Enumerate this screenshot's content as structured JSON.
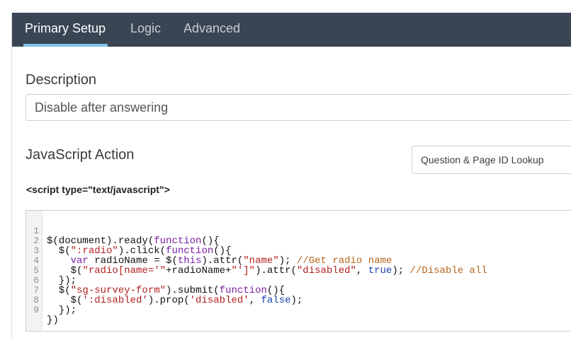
{
  "tabs": [
    "Primary Setup",
    "Logic",
    "Advanced"
  ],
  "description": {
    "label": "Description",
    "value": "Disable after answering"
  },
  "javascript_action": {
    "label": "JavaScript Action",
    "lookup_button": "Question & Page ID Lookup",
    "script_tag": "<script type=\"text/javascript\">"
  },
  "code_lines": [
    "$(document).ready(function(){",
    "  $(\":radio\").click(function(){",
    "    var radioName = $(this).attr(\"name\"); //Get radio name",
    "    $(\"radio[name='\"+radioName+\"']\").attr(\"disabled\", true); //Disable all",
    "  });",
    "  $(\"sg-survey-form\").submit(function(){",
    "    $(':disabled').prop('disabled', false);",
    "  });",
    "})"
  ],
  "code_line_numbers": [
    "1",
    "2",
    "3",
    "4",
    "5",
    "6",
    "7",
    "8",
    "9"
  ],
  "colors": {
    "tabbar_bg": "#3a4554",
    "tab_active_underline": "#7cc3e8",
    "keyword": "#7b1fa2",
    "string": "#b21f1f",
    "comment": "#b5651d",
    "boolean": "#1a3fb0"
  }
}
